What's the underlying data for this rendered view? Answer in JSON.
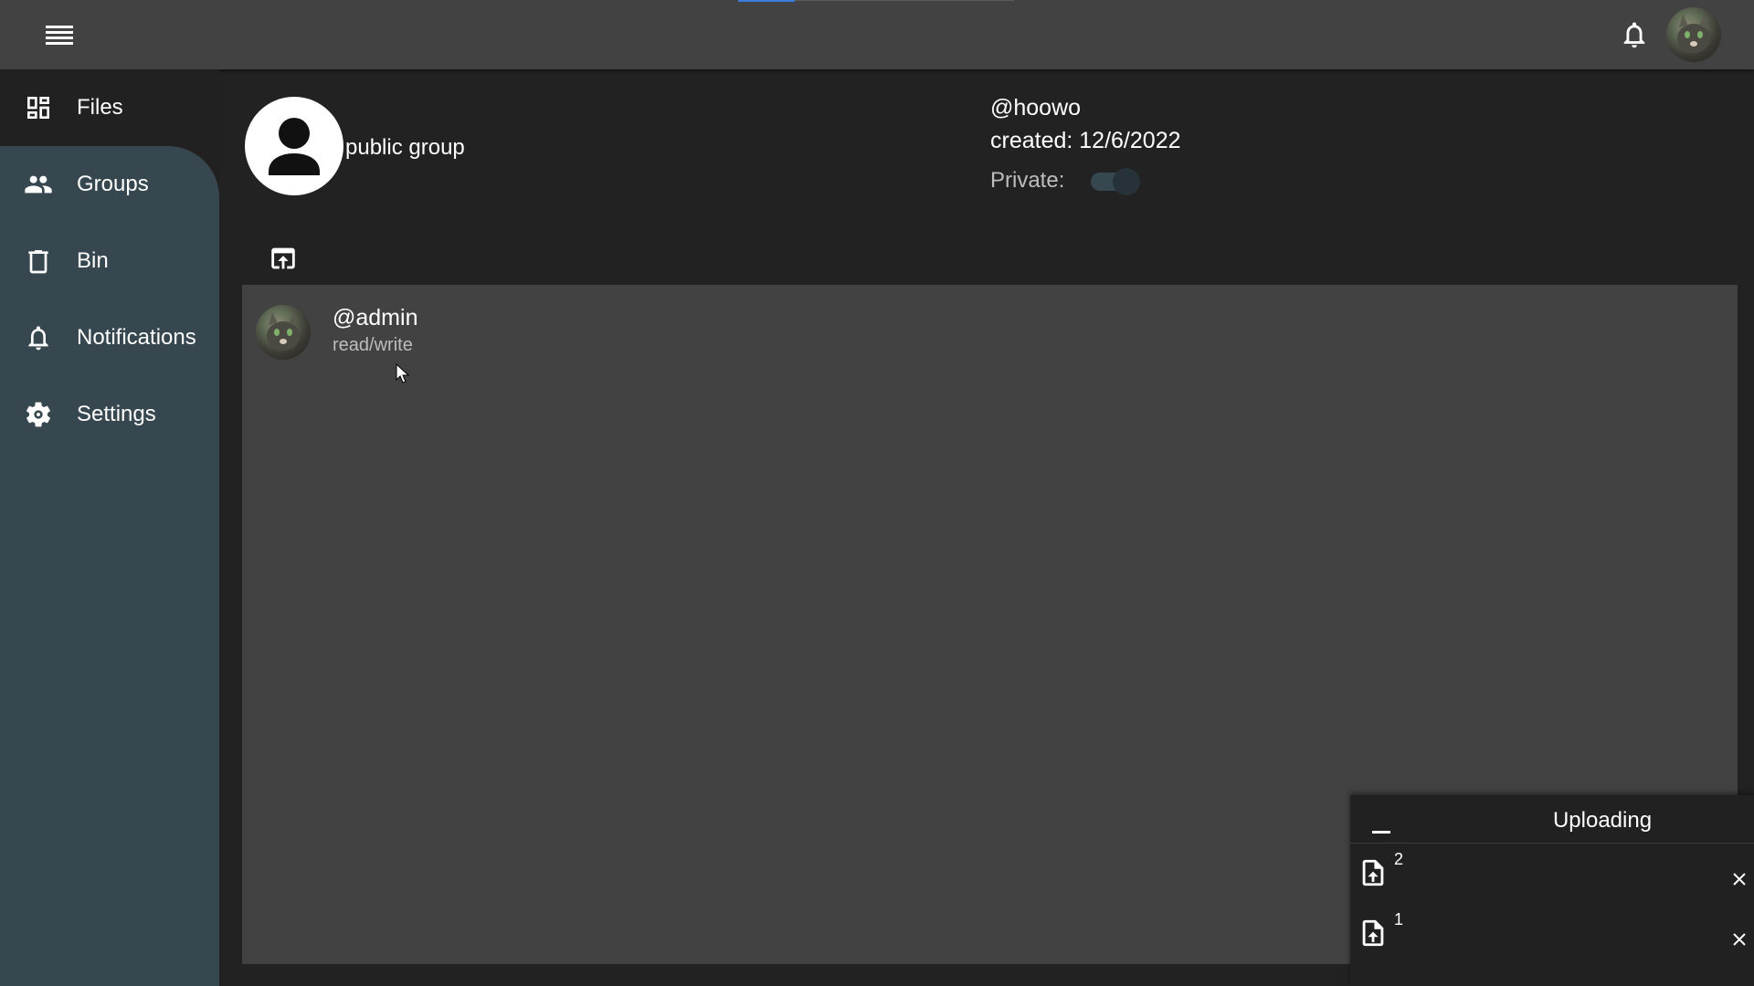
{
  "sidebar": {
    "items": [
      {
        "label": "Files",
        "icon": "dashboard-icon"
      },
      {
        "label": "Groups",
        "icon": "people-icon"
      },
      {
        "label": "Bin",
        "icon": "trash-icon"
      },
      {
        "label": "Notifications",
        "icon": "bell-icon"
      },
      {
        "label": "Settings",
        "icon": "gear-icon"
      }
    ],
    "active": "Groups"
  },
  "group": {
    "name": "public group",
    "owner": "@hoowo",
    "created": "created: 12/6/2022",
    "private_label": "Private:",
    "private": false
  },
  "members": [
    {
      "name": "@admin",
      "permission": "read/write"
    }
  ],
  "upload": {
    "title": "Uploading",
    "items": [
      {
        "name": "2"
      },
      {
        "name": "1"
      }
    ]
  },
  "colors": {
    "topbar": "#424242",
    "background": "#222222",
    "sidebar_active": "#37474f",
    "panel": "#424242",
    "accent": "#3b7ddd"
  }
}
